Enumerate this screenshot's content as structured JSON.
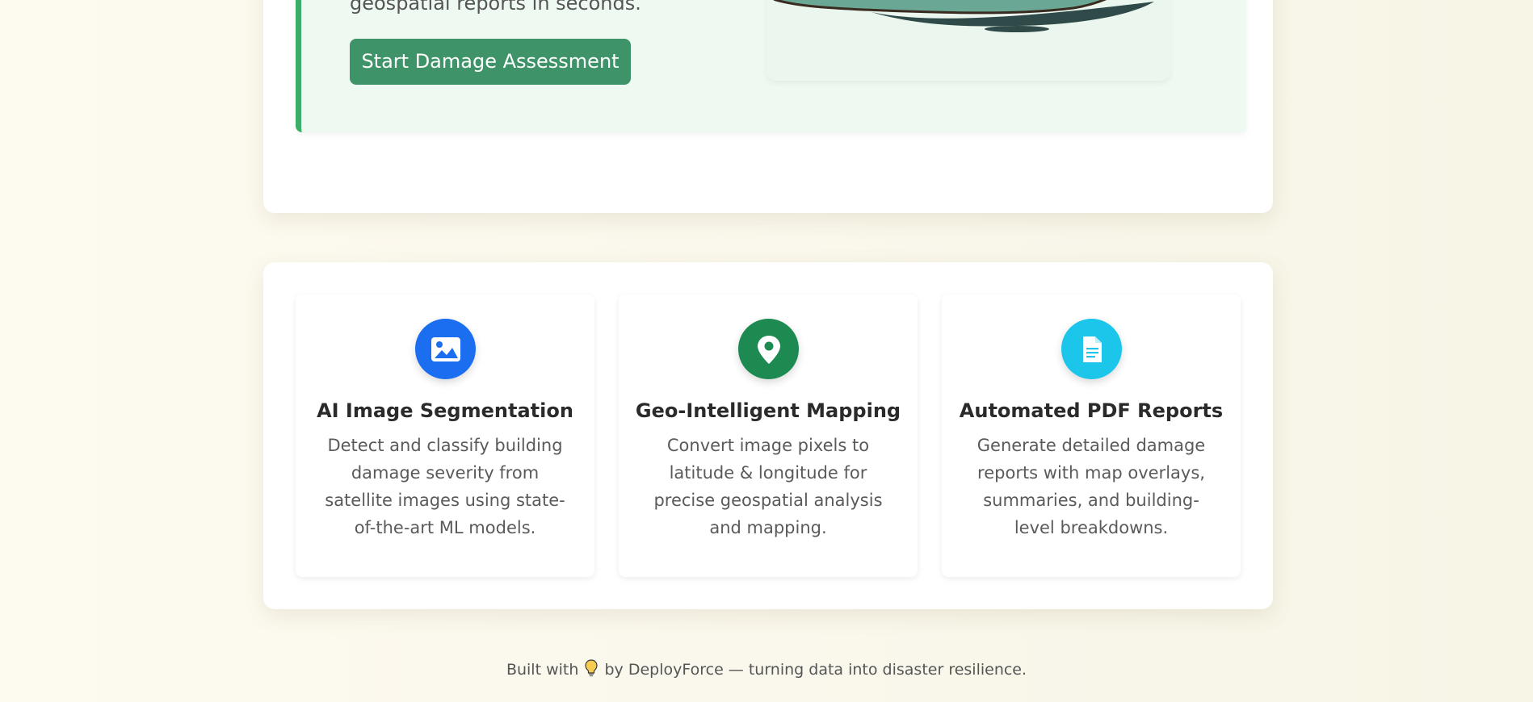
{
  "hero": {
    "text": "geospatial reports in seconds.",
    "button_label": "Start Damage Assessment"
  },
  "features": [
    {
      "icon": "image-icon",
      "color": "#1b6ef0",
      "title": "AI Image Segmentation",
      "description": "Detect and classify building damage severity from satellite images using state-of-the-art ML models."
    },
    {
      "icon": "map-pin-icon",
      "color": "#1d8a52",
      "title": "Geo-Intelligent Mapping",
      "description": "Convert image pixels to latitude & longitude for precise geospatial analysis and mapping."
    },
    {
      "icon": "document-icon",
      "color": "#1bc6ea",
      "title": "Automated PDF Reports",
      "description": "Generate detailed damage reports with map overlays, summaries, and building-level breakdowns."
    }
  ],
  "footer": {
    "prefix": "Built with",
    "icon": "lightbulb-icon",
    "suffix": "by DeployForce — turning data into disaster resilience."
  }
}
